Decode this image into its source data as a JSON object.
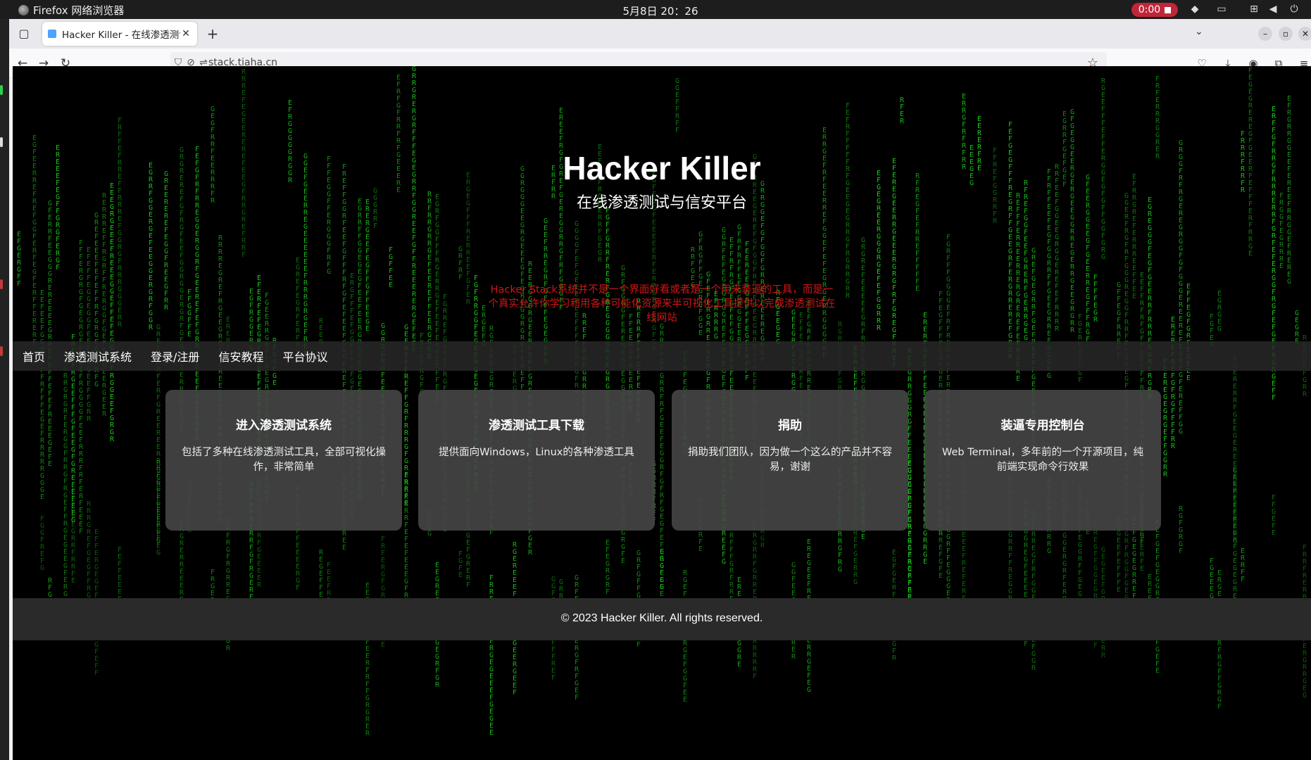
{
  "os": {
    "app_name": "Firefox 网络浏览器",
    "clock": "5月8日  20：26",
    "recording": "0:00"
  },
  "browser": {
    "tab_title": "Hacker Killer - 在线渗透测试",
    "url": "stack.tiaha.cn"
  },
  "hero": {
    "title": "Hacker Killer",
    "subtitle": "在线渗透测试与信安平台",
    "description": "Hacker Stack系统并不是一个界面好看或者是一个用来装逼的工具，而是一个真实允许你学习利用各种可能化资源来半可视化工具提供以完成渗透测试在线网站"
  },
  "nav": {
    "items": [
      "首页",
      "渗透测试系统",
      "登录/注册",
      "信安教程",
      "平台协议"
    ]
  },
  "cards": [
    {
      "title": "进入渗透测试系统",
      "desc": "包括了多种在线渗透测试工具，全部可视化操作，非常简单"
    },
    {
      "title": "渗透测试工具下载",
      "desc": "提供面向Windows，Linux的各种渗透工具"
    },
    {
      "title": "捐助",
      "desc": "捐助我们团队，因为做一个这么的产品并不容易，谢谢"
    },
    {
      "title": "装逼专用控制台",
      "desc": "Web Terminal，多年前的一个开源项目，纯前端实现命令行效果"
    }
  ],
  "footer": {
    "text": "© 2023 Hacker Killer. All rights reserved."
  },
  "colors": {
    "matrix_green": "#1ccf1c",
    "description_red": "#d01616",
    "recording_badge": "#c0263a"
  }
}
